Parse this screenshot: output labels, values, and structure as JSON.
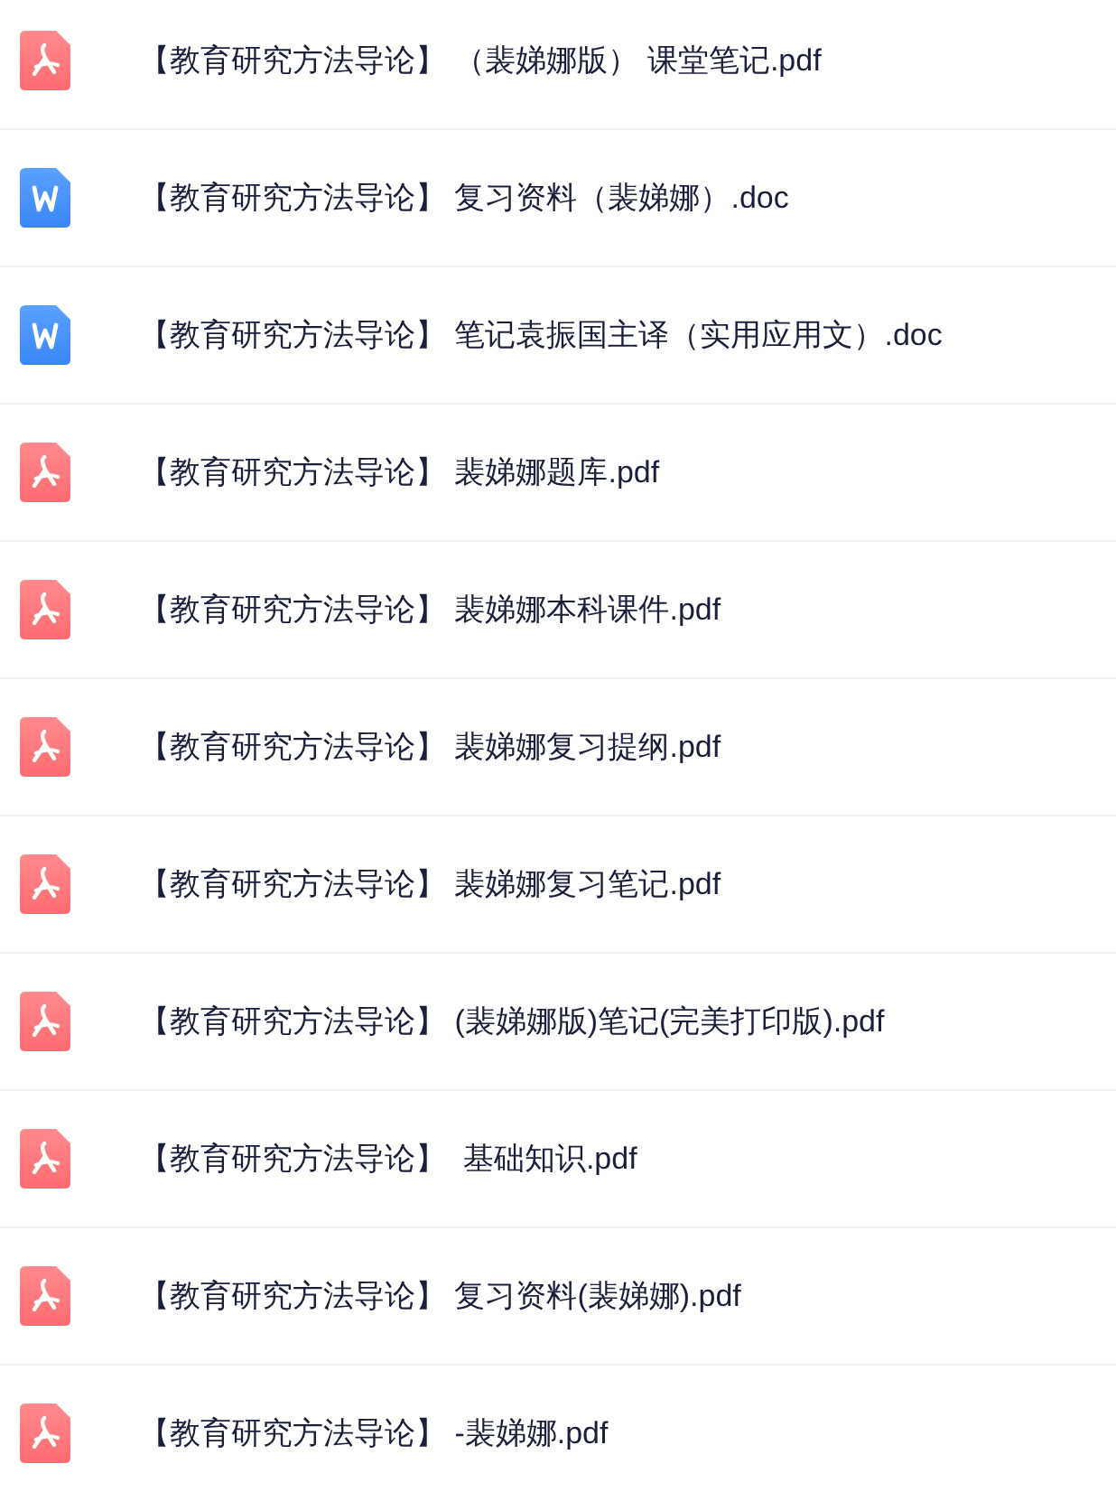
{
  "files": [
    {
      "kind": "pdf",
      "name": "【教育研究方法导论】 （裴娣娜版） 课堂笔记.pdf"
    },
    {
      "kind": "doc",
      "name": "【教育研究方法导论】 复习资料（裴娣娜）.doc"
    },
    {
      "kind": "doc",
      "name": "【教育研究方法导论】 笔记袁振国主译（实用应用文）.doc"
    },
    {
      "kind": "pdf",
      "name": "【教育研究方法导论】 裴娣娜题库.pdf"
    },
    {
      "kind": "pdf",
      "name": "【教育研究方法导论】 裴娣娜本科课件.pdf"
    },
    {
      "kind": "pdf",
      "name": "【教育研究方法导论】 裴娣娜复习提纲.pdf"
    },
    {
      "kind": "pdf",
      "name": "【教育研究方法导论】 裴娣娜复习笔记.pdf"
    },
    {
      "kind": "pdf",
      "name": "【教育研究方法导论】 (裴娣娜版)笔记(完美打印版).pdf"
    },
    {
      "kind": "pdf",
      "name": "【教育研究方法导论】  基础知识.pdf"
    },
    {
      "kind": "pdf",
      "name": "【教育研究方法导论】 复习资料(裴娣娜).pdf"
    },
    {
      "kind": "pdf",
      "name": "【教育研究方法导论】 -裴娣娜.pdf"
    }
  ]
}
